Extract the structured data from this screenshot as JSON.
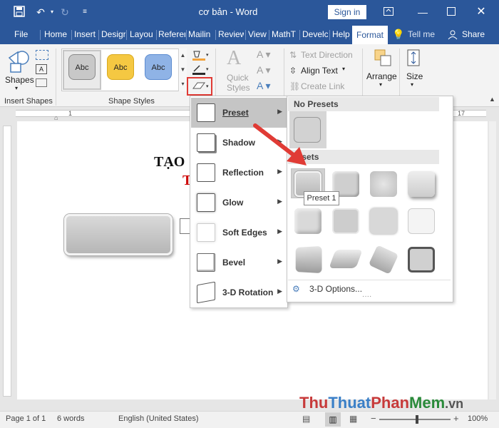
{
  "titlebar": {
    "doc_title": "cơ bản  -  Word",
    "signin": "Sign in"
  },
  "tabs": [
    "File",
    "Home",
    "Insert",
    "Desigr",
    "Layou",
    "Referer",
    "Mailin",
    "Review",
    "View",
    "MathT",
    "Develc",
    "Help",
    "Format"
  ],
  "active_tab": "Format",
  "tell_me": "Tell me",
  "share": "Share",
  "ribbon": {
    "insert_shapes": {
      "shapes_label": "Shapes",
      "group": "Insert Shapes"
    },
    "shape_styles": {
      "swatches": [
        "Abc",
        "Abc",
        "Abc"
      ],
      "group": "Shape Styles"
    },
    "quick_styles": "Quick\nStyles",
    "text_direction": "Text Direction",
    "align_text": "Align Text",
    "create_link": "Create Link",
    "arrange": "Arrange",
    "size": "Size"
  },
  "ruler_numbers": [
    "1",
    "17"
  ],
  "document": {
    "heading": "TẠO",
    "subheading": "T"
  },
  "menu": {
    "items": [
      {
        "label": "Preset"
      },
      {
        "label": "Shadow"
      },
      {
        "label": "Reflection"
      },
      {
        "label": "Glow"
      },
      {
        "label": "Soft Edges"
      },
      {
        "label": "Bevel"
      },
      {
        "label": "3-D Rotation"
      }
    ]
  },
  "flyout": {
    "no_presets": "No Presets",
    "presets": "resets",
    "tooltip": "Preset 1",
    "options": "3-D Options..."
  },
  "status": {
    "page": "Page 1 of 1",
    "words": "6 words",
    "language": "English (United States)",
    "zoom": "100%"
  },
  "watermark": {
    "thu": "Thu",
    "thuat": "Thuat",
    "phan": "Phan",
    "mem": "Mem",
    "vn": ".vn"
  },
  "colors": {
    "brand": "#2b579a",
    "red_arrow": "#e03b35",
    "swatch_gray": "#c8c8c8",
    "swatch_orange": "#f5c842",
    "swatch_blue": "#8fb3e6"
  }
}
